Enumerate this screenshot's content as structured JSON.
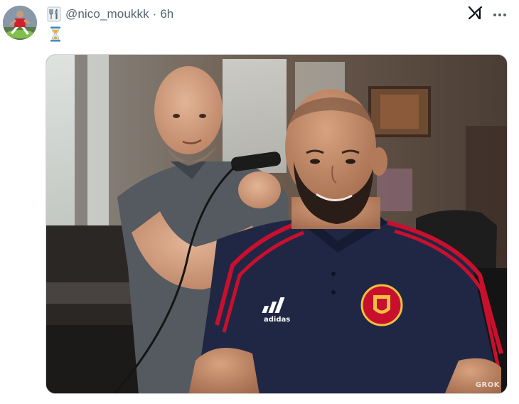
{
  "post": {
    "handle": "@nico_moukkk",
    "separator": "·",
    "timestamp": "6h",
    "name_emoji": "fork-and-knife-icon",
    "body_emoji": "hourglass-icon"
  },
  "actions": {
    "grok_icon": "grok-icon",
    "more_icon": "more-options-icon"
  },
  "media": {
    "watermark": "GROK",
    "shirt_brand": "adidas"
  },
  "colors": {
    "text_secondary": "#536471",
    "shirt_navy": "#1f2744",
    "shirt_red": "#c8102e"
  }
}
